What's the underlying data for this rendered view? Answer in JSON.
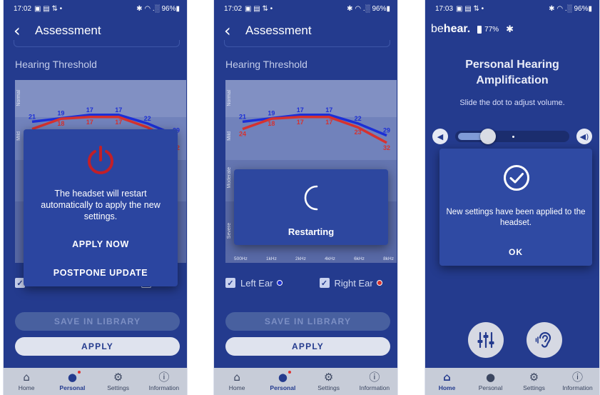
{
  "screens": [
    {
      "status": {
        "time": "17:02",
        "icons": "▣ ▤ ⇅ •",
        "right": "✱ ◠ .░ 96%▮"
      },
      "title": "Assessment",
      "section": "Hearing Threshold",
      "dialog": {
        "message": "The headset will restart automatically to apply the new settings.",
        "primary": "APPLY NOW",
        "secondary": "POSTPONE UPDATE"
      },
      "save_label": "SAVE IN LIBRARY",
      "apply_label": "APPLY"
    },
    {
      "status": {
        "time": "17:02",
        "icons": "▣ ▤ ⇅ •",
        "right": "✱ ◠ .░ 96%▮"
      },
      "title": "Assessment",
      "section": "Hearing Threshold",
      "dialog": {
        "message": "Restarting"
      },
      "left_ear": "Left Ear",
      "right_ear": "Right Ear",
      "save_label": "SAVE IN LIBRARY",
      "apply_label": "APPLY"
    },
    {
      "status": {
        "time": "17:03",
        "icons": "▣ ▤ ⇅ •",
        "right": "✱ ◠ .░ 96%▮"
      },
      "brand_prefix": "be",
      "brand_bold": "hear.",
      "battery": "77%",
      "title_line1": "Personal Hearing",
      "title_line2": "Amplification",
      "subtitle": "Slide the dot to adjust volume.",
      "volume_level": 0.08,
      "dialog": {
        "message": "New settings have been applied to the headset.",
        "ok": "OK"
      }
    }
  ],
  "chart_data": {
    "type": "line",
    "categories": [
      "500Hz",
      "1kHz",
      "2kHz",
      "4kHz",
      "6kHz",
      "8kHz"
    ],
    "bands": [
      "Normal",
      "Mild",
      "Moderate",
      "Severe"
    ],
    "series": [
      {
        "name": "Left Ear",
        "color": "#1c2fd6",
        "values": [
          21,
          19,
          17,
          17,
          22,
          29
        ]
      },
      {
        "name": "Right Ear",
        "color": "#d6322f",
        "values": [
          24,
          18,
          17,
          17,
          23,
          32
        ]
      }
    ],
    "ylim": [
      0,
      100
    ],
    "labels_top": [
      "21",
      "19",
      "17",
      "17",
      "22",
      "29"
    ],
    "labels_bottom": [
      "24",
      "18",
      "17",
      "17",
      "23",
      "32"
    ]
  },
  "nav": [
    {
      "label": "Home",
      "icon": "home-icon"
    },
    {
      "label": "Personal",
      "icon": "person-icon"
    },
    {
      "label": "Settings",
      "icon": "gear-icon"
    },
    {
      "label": "Information",
      "icon": "info-icon"
    }
  ],
  "colors": {
    "background": "#243b8e",
    "dialog": "#2b45a0",
    "power_red": "#c21f28",
    "navbar": "#c7ccd8"
  }
}
